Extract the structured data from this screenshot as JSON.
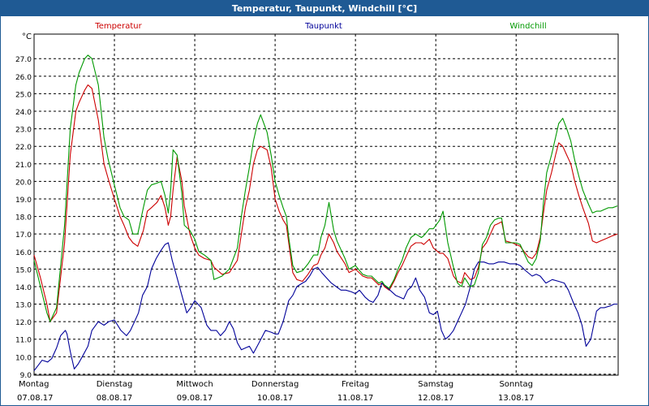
{
  "window": {
    "title": "Temperatur, Taupunkt, Windchill [°C]"
  },
  "chart_data": {
    "type": "line",
    "ylabel": "°C",
    "ylim": [
      8.95,
      28.4
    ],
    "yticks": [
      9.0,
      10.0,
      11.0,
      12.0,
      13.0,
      14.0,
      15.0,
      16.0,
      17.0,
      18.0,
      19.0,
      20.0,
      21.0,
      22.0,
      23.0,
      24.0,
      25.0,
      26.0,
      27.0
    ],
    "xlim": [
      0,
      7.27
    ],
    "grid": true,
    "days": [
      {
        "name": "Montag",
        "date": "07.08.17"
      },
      {
        "name": "Dienstag",
        "date": "08.08.17"
      },
      {
        "name": "Mittwoch",
        "date": "09.08.17"
      },
      {
        "name": "Donnerstag",
        "date": "10.08.17"
      },
      {
        "name": "Freitag",
        "date": "11.08.17"
      },
      {
        "name": "Samstag",
        "date": "12.08.17"
      },
      {
        "name": "Sonntag",
        "date": "13.08.17"
      }
    ],
    "series": [
      {
        "name": "Temperatur",
        "color": "#cc0000",
        "x": [
          0,
          0.08,
          0.16,
          0.2,
          0.28,
          0.38,
          0.45,
          0.52,
          0.56,
          0.63,
          0.67,
          0.72,
          0.8,
          0.87,
          0.92,
          1.0,
          1.07,
          1.12,
          1.18,
          1.23,
          1.29,
          1.36,
          1.41,
          1.46,
          1.53,
          1.58,
          1.63,
          1.67,
          1.7,
          1.73,
          1.78,
          1.84,
          1.87,
          1.94,
          2.0,
          2.05,
          2.12,
          2.2,
          2.24,
          2.34,
          2.43,
          2.53,
          2.58,
          2.63,
          2.68,
          2.73,
          2.78,
          2.82,
          2.9,
          2.95,
          3.0,
          3.05,
          3.1,
          3.14,
          3.17,
          3.22,
          3.27,
          3.34,
          3.41,
          3.48,
          3.53,
          3.57,
          3.62,
          3.67,
          3.73,
          3.77,
          3.87,
          3.92,
          4.0,
          4.09,
          4.15,
          4.2,
          4.29,
          4.33,
          4.36,
          4.42,
          4.48,
          4.53,
          4.58,
          4.63,
          4.69,
          4.75,
          4.82,
          4.85,
          4.92,
          4.97,
          5.05,
          5.09,
          5.15,
          5.22,
          5.27,
          5.32,
          5.36,
          5.43,
          5.48,
          5.53,
          5.58,
          5.63,
          5.68,
          5.73,
          5.78,
          5.82,
          5.87,
          5.95,
          6.0,
          6.05,
          6.1,
          6.15,
          6.2,
          6.25,
          6.3,
          6.34,
          6.38,
          6.44,
          6.49,
          6.53,
          6.58,
          6.63,
          6.68,
          6.73,
          6.78,
          6.83,
          6.9,
          6.95,
          7.0,
          7.05,
          7.1,
          7.15,
          7.2,
          7.26
        ],
        "values": [
          15.8,
          14.5,
          13.0,
          12.0,
          12.5,
          16.5,
          21.5,
          24.0,
          24.5,
          25.2,
          25.5,
          25.3,
          23.5,
          21.0,
          20.2,
          19.0,
          18.0,
          17.5,
          16.8,
          16.5,
          16.3,
          17.2,
          18.3,
          18.5,
          18.8,
          19.2,
          18.5,
          17.5,
          18.0,
          19.5,
          21.4,
          20.0,
          18.6,
          17.0,
          16.2,
          15.8,
          15.6,
          15.5,
          15.1,
          14.7,
          14.8,
          15.5,
          17.0,
          18.5,
          19.5,
          21.0,
          21.8,
          22.0,
          21.8,
          20.8,
          19.0,
          18.3,
          17.8,
          17.5,
          16.5,
          14.8,
          14.4,
          14.3,
          14.7,
          15.2,
          15.3,
          15.8,
          16.2,
          17.0,
          16.5,
          16.0,
          15.3,
          14.8,
          15.0,
          14.6,
          14.5,
          14.5,
          14.1,
          14.2,
          14.0,
          13.8,
          14.3,
          14.8,
          15.2,
          15.7,
          16.3,
          16.5,
          16.5,
          16.4,
          16.7,
          16.2,
          15.9,
          15.9,
          15.6,
          14.6,
          14.3,
          14.2,
          14.8,
          14.4,
          14.5,
          15.1,
          16.2,
          16.5,
          17.0,
          17.5,
          17.6,
          17.7,
          16.6,
          16.5,
          16.4,
          16.3,
          16.0,
          15.7,
          15.6,
          15.9,
          16.8,
          18.2,
          19.5,
          20.5,
          21.5,
          22.2,
          22.0,
          21.5,
          21.0,
          20.0,
          19.2,
          18.5,
          17.6,
          16.6,
          16.5,
          16.6,
          16.7,
          16.8,
          16.9,
          17.0
        ]
      },
      {
        "name": "Taupunkt",
        "color": "#000099",
        "x": [
          0,
          0.05,
          0.1,
          0.17,
          0.22,
          0.28,
          0.33,
          0.39,
          0.41,
          0.45,
          0.5,
          0.55,
          0.6,
          0.67,
          0.72,
          0.8,
          0.87,
          0.93,
          1.0,
          1.08,
          1.15,
          1.2,
          1.25,
          1.3,
          1.35,
          1.41,
          1.46,
          1.52,
          1.57,
          1.63,
          1.67,
          1.72,
          1.78,
          1.84,
          1.9,
          1.95,
          2.0,
          2.08,
          2.15,
          2.2,
          2.27,
          2.32,
          2.38,
          2.43,
          2.48,
          2.53,
          2.58,
          2.63,
          2.68,
          2.73,
          2.8,
          2.88,
          2.95,
          3.0,
          3.04,
          3.1,
          3.17,
          3.22,
          3.27,
          3.34,
          3.38,
          3.43,
          3.48,
          3.53,
          3.58,
          3.64,
          3.7,
          3.76,
          3.82,
          3.88,
          3.95,
          4.0,
          4.05,
          4.12,
          4.17,
          4.22,
          4.28,
          4.33,
          4.38,
          4.43,
          4.5,
          4.55,
          4.6,
          4.65,
          4.7,
          4.75,
          4.8,
          4.86,
          4.92,
          4.97,
          5.02,
          5.07,
          5.12,
          5.17,
          5.22,
          5.27,
          5.32,
          5.37,
          5.43,
          5.48,
          5.53,
          5.6,
          5.66,
          5.72,
          5.78,
          5.85,
          5.92,
          6.0,
          6.05,
          6.12,
          6.2,
          6.25,
          6.3,
          6.37,
          6.45,
          6.53,
          6.6,
          6.65,
          6.72,
          6.77,
          6.82,
          6.87,
          6.93,
          7.0,
          7.05,
          7.1,
          7.17,
          7.22,
          7.26
        ],
        "values": [
          9.2,
          9.5,
          9.8,
          9.7,
          9.9,
          10.5,
          11.2,
          11.5,
          11.3,
          10.3,
          9.3,
          9.6,
          10.0,
          10.6,
          11.5,
          12.0,
          11.8,
          12.0,
          12.1,
          11.5,
          11.2,
          11.5,
          12.0,
          12.5,
          13.5,
          14.0,
          15.0,
          15.6,
          16.0,
          16.4,
          16.5,
          15.5,
          14.5,
          13.5,
          12.5,
          12.8,
          13.2,
          12.8,
          11.8,
          11.5,
          11.5,
          11.2,
          11.5,
          12.0,
          11.6,
          10.8,
          10.4,
          10.5,
          10.6,
          10.2,
          10.8,
          11.5,
          11.4,
          11.3,
          11.3,
          12.0,
          13.2,
          13.5,
          14.0,
          14.2,
          14.3,
          14.6,
          15.0,
          15.1,
          14.8,
          14.5,
          14.2,
          14.0,
          13.8,
          13.8,
          13.7,
          13.6,
          13.8,
          13.4,
          13.2,
          13.1,
          13.5,
          14.2,
          14.0,
          13.8,
          13.5,
          13.4,
          13.3,
          13.8,
          14.0,
          14.5,
          13.8,
          13.4,
          12.5,
          12.4,
          12.6,
          11.5,
          11.0,
          11.2,
          11.5,
          12.0,
          12.5,
          13.0,
          14.0,
          15.0,
          15.4,
          15.4,
          15.3,
          15.3,
          15.4,
          15.4,
          15.3,
          15.3,
          15.2,
          14.9,
          14.6,
          14.7,
          14.6,
          14.2,
          14.4,
          14.3,
          14.2,
          13.8,
          13.0,
          12.5,
          11.8,
          10.6,
          11.0,
          12.6,
          12.8,
          12.8,
          12.9,
          13.0,
          13.0
        ]
      },
      {
        "name": "Windchill",
        "color": "#009900",
        "x": [
          0,
          0.08,
          0.16,
          0.2,
          0.28,
          0.38,
          0.45,
          0.52,
          0.56,
          0.63,
          0.67,
          0.72,
          0.8,
          0.87,
          0.92,
          1.0,
          1.07,
          1.12,
          1.18,
          1.23,
          1.29,
          1.36,
          1.41,
          1.46,
          1.53,
          1.58,
          1.63,
          1.67,
          1.7,
          1.73,
          1.78,
          1.84,
          1.87,
          1.94,
          2.0,
          2.05,
          2.12,
          2.2,
          2.24,
          2.34,
          2.43,
          2.53,
          2.58,
          2.63,
          2.68,
          2.73,
          2.78,
          2.82,
          2.9,
          2.95,
          3.0,
          3.05,
          3.1,
          3.14,
          3.17,
          3.22,
          3.27,
          3.34,
          3.41,
          3.48,
          3.53,
          3.57,
          3.62,
          3.67,
          3.73,
          3.77,
          3.87,
          3.92,
          4.0,
          4.09,
          4.15,
          4.2,
          4.29,
          4.33,
          4.36,
          4.42,
          4.48,
          4.53,
          4.58,
          4.63,
          4.69,
          4.75,
          4.82,
          4.85,
          4.92,
          4.97,
          5.05,
          5.09,
          5.15,
          5.22,
          5.27,
          5.32,
          5.36,
          5.43,
          5.48,
          5.53,
          5.58,
          5.63,
          5.68,
          5.73,
          5.78,
          5.82,
          5.87,
          5.95,
          6.0,
          6.05,
          6.1,
          6.15,
          6.2,
          6.25,
          6.3,
          6.34,
          6.38,
          6.44,
          6.49,
          6.53,
          6.58,
          6.63,
          6.68,
          6.73,
          6.78,
          6.83,
          6.9,
          6.95,
          7.0,
          7.05,
          7.1,
          7.15,
          7.2,
          7.26
        ],
        "values": [
          15.5,
          14.0,
          12.5,
          12.0,
          12.8,
          17.5,
          23.0,
          25.5,
          26.2,
          27.0,
          27.2,
          27.0,
          25.5,
          22.5,
          21.3,
          19.8,
          18.5,
          18.0,
          17.8,
          17.0,
          17.0,
          18.5,
          19.5,
          19.8,
          19.9,
          20.0,
          19.2,
          18.2,
          19.5,
          21.8,
          21.5,
          19.3,
          17.5,
          17.2,
          16.7,
          16.0,
          15.8,
          15.5,
          14.4,
          14.6,
          15.0,
          16.2,
          18.0,
          19.5,
          20.8,
          22.3,
          23.3,
          23.8,
          22.8,
          21.5,
          20.0,
          19.2,
          18.5,
          18.0,
          16.8,
          15.2,
          14.8,
          14.9,
          15.3,
          15.8,
          15.8,
          16.8,
          17.5,
          18.8,
          17.2,
          16.6,
          15.6,
          15.0,
          15.2,
          14.7,
          14.6,
          14.6,
          14.2,
          14.3,
          14.1,
          13.9,
          14.4,
          15.0,
          15.5,
          16.2,
          16.8,
          17.0,
          16.8,
          16.9,
          17.3,
          17.3,
          17.8,
          18.3,
          16.5,
          15.1,
          14.2,
          14.0,
          14.5,
          14.0,
          14.1,
          14.8,
          16.4,
          16.8,
          17.5,
          17.8,
          17.9,
          17.9,
          16.5,
          16.5,
          16.5,
          16.4,
          15.9,
          15.4,
          15.2,
          15.6,
          16.6,
          18.8,
          20.5,
          21.5,
          22.5,
          23.3,
          23.6,
          23.0,
          22.3,
          21.2,
          20.3,
          19.5,
          18.7,
          18.2,
          18.3,
          18.3,
          18.4,
          18.5,
          18.5,
          18.6
        ]
      }
    ]
  }
}
